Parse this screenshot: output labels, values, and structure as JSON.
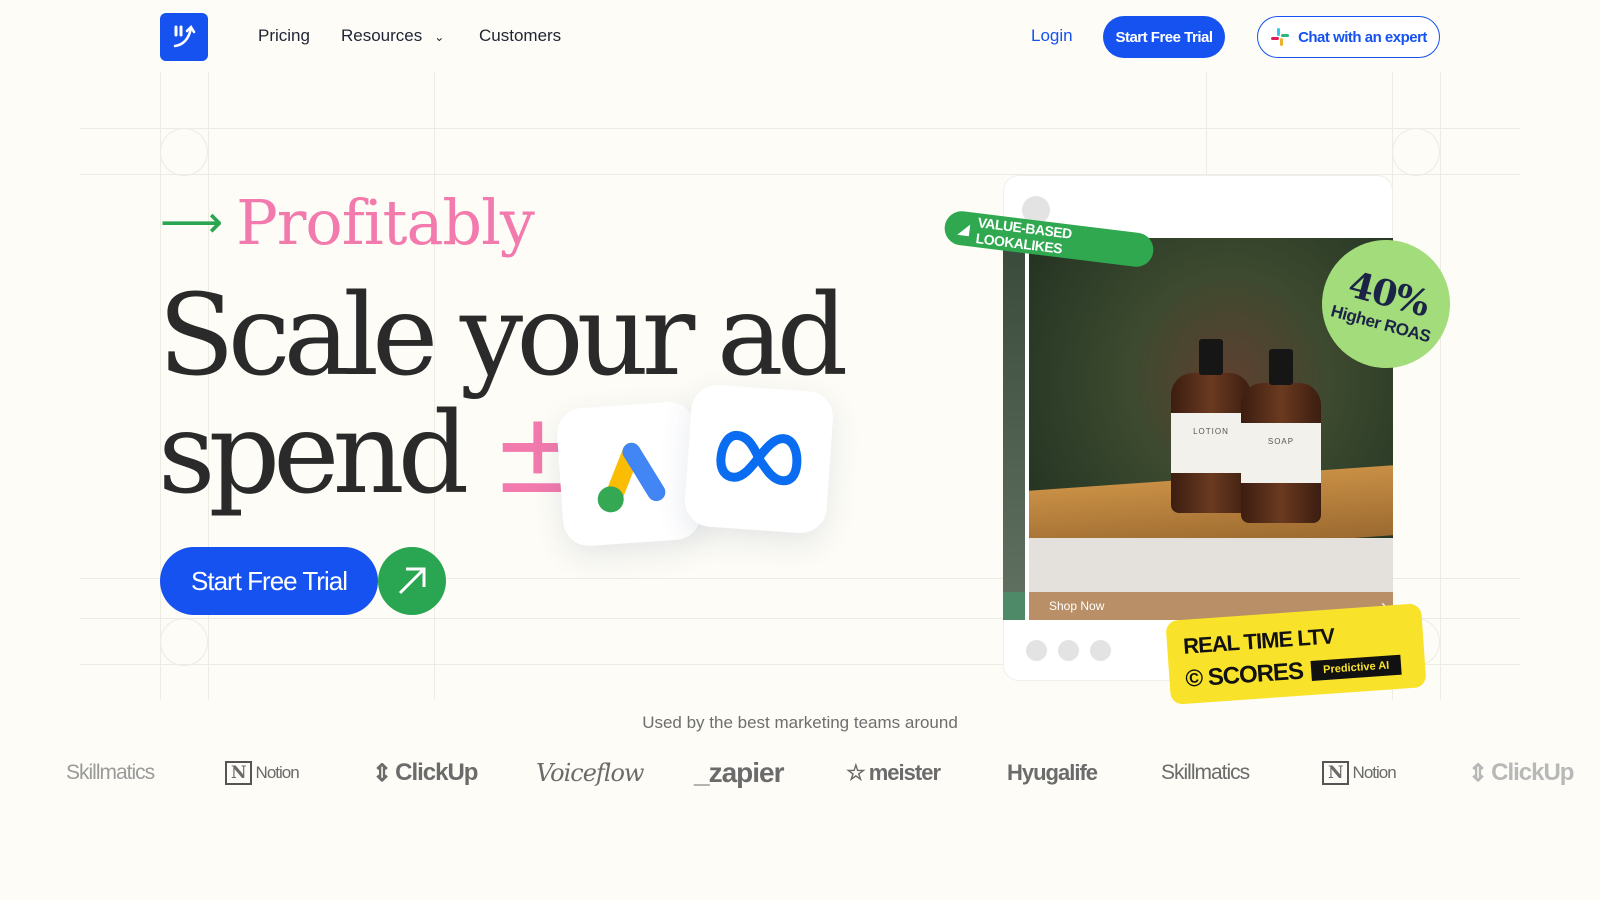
{
  "nav": {
    "links": [
      {
        "label": "Pricing"
      },
      {
        "label": "Resources"
      },
      {
        "label": "Customers"
      }
    ],
    "login": "Login",
    "start_trial": "Start Free Trial",
    "chat": "Chat with an expert",
    "brand_color": "#1652f0"
  },
  "hero": {
    "kicker": "Profitably",
    "line1": "Scale your ad",
    "line2": "spend",
    "line2_accent": "±",
    "cta": "Start Free Trial",
    "accent_pink": "#f27aad",
    "accent_green": "#2aa652"
  },
  "ad_card": {
    "badge": "VALUE-BASED LOOKALIKES",
    "roas_value": "40%",
    "roas_label": "Higher ROAS",
    "bottle1": "LOTION",
    "bottle2": "SOAP",
    "shop": "Shop Now",
    "ltv_line1": "REAL TIME LTV",
    "ltv_line2": "© SCORES",
    "ltv_tag": "Predictive AI"
  },
  "social_proof": {
    "caption": "Used by the best marketing teams around",
    "logos": [
      "Skillmatics",
      "Notion",
      "ClickUp",
      "Voiceflow",
      "_zapier",
      "meister",
      "Hyugalife",
      "Skillmatics",
      "Notion",
      "ClickUp"
    ]
  }
}
